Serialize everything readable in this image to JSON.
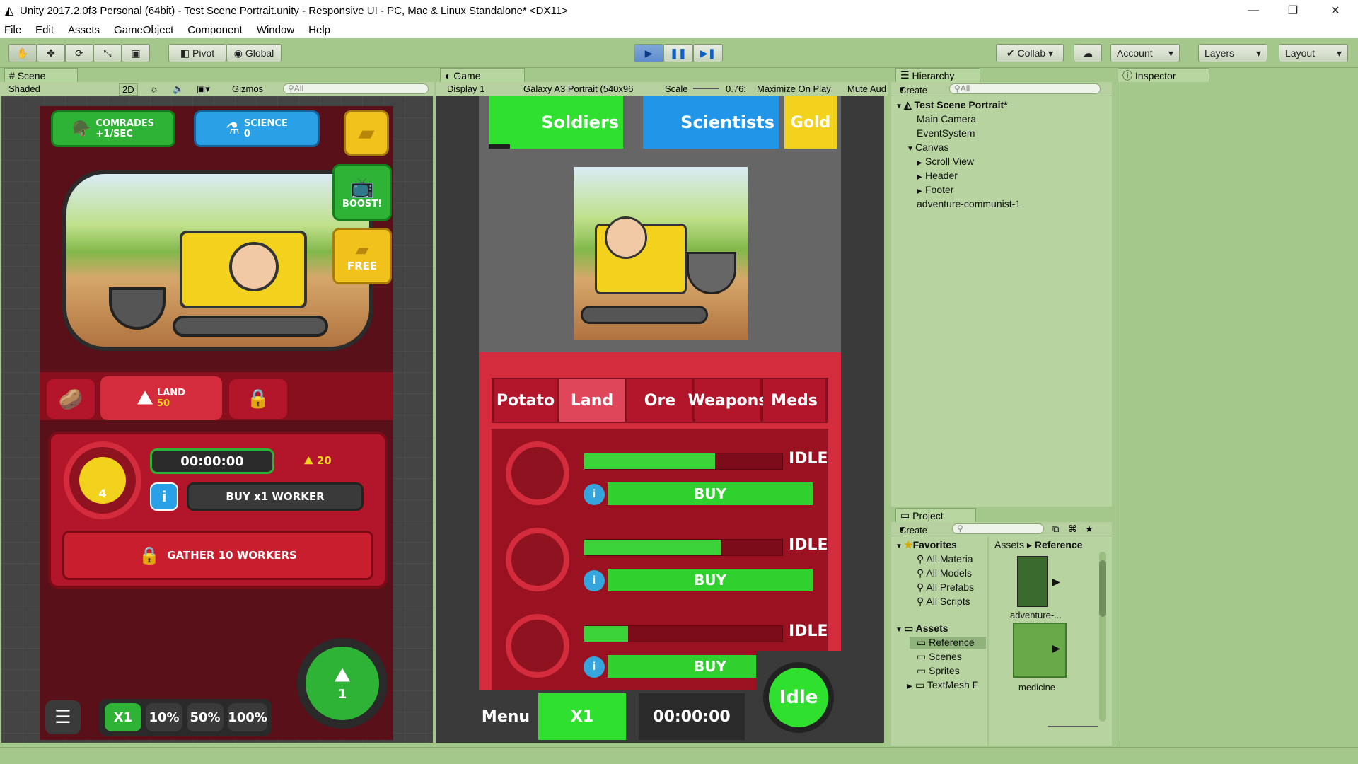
{
  "window": {
    "title": "Unity 2017.2.0f3 Personal (64bit) - Test Scene Portrait.unity - Responsive UI - PC, Mac & Linux Standalone* <DX11>",
    "min_symbol": "—",
    "max_symbol": "❐",
    "close_symbol": "✕"
  },
  "menu": [
    "File",
    "Edit",
    "Assets",
    "GameObject",
    "Component",
    "Window",
    "Help"
  ],
  "toolbar": {
    "pivot_label": "Pivot",
    "global_label": "Global",
    "collab_label": "Collab",
    "account_label": "Account",
    "layers_label": "Layers",
    "layout_label": "Layout"
  },
  "scene_panel": {
    "tab_label": "Scene",
    "shading": "Shaded",
    "mode_2d": "2D",
    "gizmos_label": "Gizmos",
    "search_placeholder": "All"
  },
  "scene_game": {
    "comrades_label": "COMRADES",
    "comrades_rate": "+1/SEC",
    "science_label": "SCIENCE",
    "science_value": "0",
    "boost_label": "BOOST!",
    "free_label": "FREE",
    "land_label": "LAND",
    "land_value": "50",
    "timer": "00:00:00",
    "worker_count": "4",
    "cost_value": "20",
    "buy_worker_label": "BUY x1 WORKER",
    "gather_label": "GATHER 10 WORKERS",
    "multipliers": [
      "X1",
      "10%",
      "50%",
      "100%"
    ],
    "circle_value": "1"
  },
  "game_panel": {
    "tab_label": "Game",
    "display": "Display 1",
    "resolution": "Galaxy A3 Portrait (540x96",
    "scale_label": "Scale",
    "scale_value": "0.76:",
    "maximize_label": "Maximize On Play",
    "mute_label": "Mute Aud"
  },
  "game": {
    "soldiers_label": "Soldiers",
    "scientists_label": "Scientists",
    "gold_label": "Gold",
    "tabs": [
      "Potato",
      "Land",
      "Ore",
      "Weapons",
      "Meds"
    ],
    "rows": [
      {
        "status": "IDLE",
        "buy": "BUY",
        "progress": 0.66
      },
      {
        "status": "IDLE",
        "buy": "BUY",
        "progress": 0.69
      },
      {
        "status": "IDLE",
        "buy": "BUY",
        "progress": 0.22
      }
    ],
    "info_glyph": "i",
    "menu_label": "Menu",
    "multiplier_label": "X1",
    "timer": "00:00:00",
    "idle_label": "Idle"
  },
  "hierarchy": {
    "tab_label": "Hierarchy",
    "create_label": "Create",
    "search_placeholder": "All",
    "scene_name": "Test Scene Portrait*",
    "items": [
      "Main Camera",
      "EventSystem",
      "Canvas",
      "Scroll View",
      "Header",
      "Footer",
      "adventure-communist-1"
    ]
  },
  "inspector": {
    "tab_label": "Inspector"
  },
  "project": {
    "tab_label": "Project",
    "create_label": "Create",
    "favorites_label": "Favorites",
    "favorites": [
      "All Materia",
      "All Models",
      "All Prefabs",
      "All Scripts"
    ],
    "assets_label": "Assets",
    "folders": [
      "Reference",
      "Scenes",
      "Sprites",
      "TextMesh F"
    ],
    "breadcrumb_root": "Assets",
    "breadcrumb_current": "Reference",
    "files": [
      "adventure-...",
      "medicine"
    ]
  },
  "colors": {
    "editor_bg": "#a4c78b",
    "game_red": "#b3162a",
    "game_green": "#30d02e",
    "game_blue": "#2196e8",
    "game_yellow": "#f2d21c"
  }
}
